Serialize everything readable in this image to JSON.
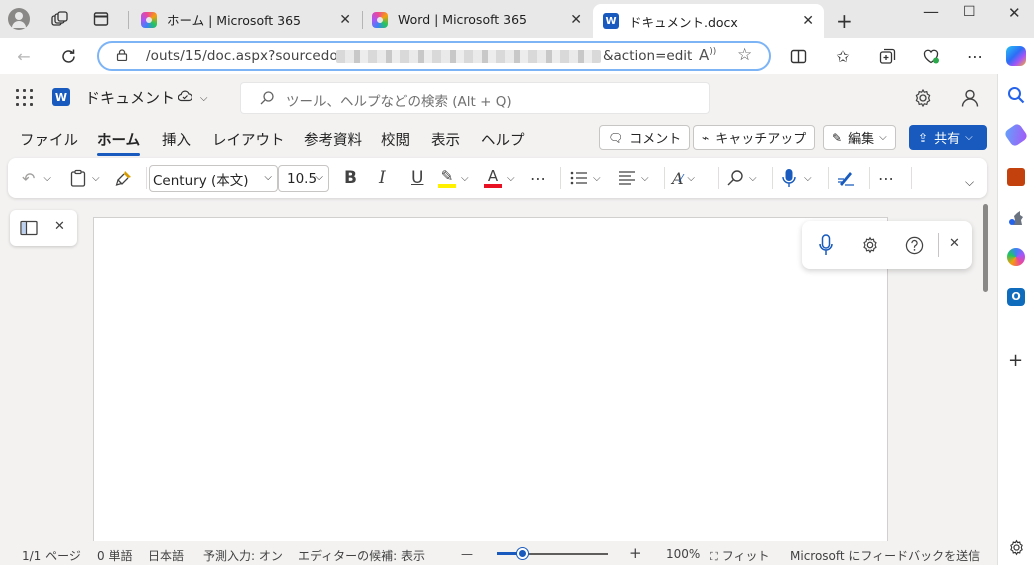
{
  "browser": {
    "tabs": [
      {
        "title": "ホーム | Microsoft 365",
        "active": false
      },
      {
        "title": "Word | Microsoft 365",
        "active": false
      },
      {
        "title": "ドキュメント.docx",
        "active": true
      }
    ],
    "address": {
      "url_start": "/outs/15/doc.aspx?sourcedoc=",
      "url_end": "&action=edit"
    },
    "colors": {
      "accent": "#185abd",
      "address_border": "#7db4f5"
    }
  },
  "word": {
    "doc_title": "ドキュメント",
    "search_placeholder": "ツール、ヘルプなどの検索 (Alt + Q)",
    "menu_tabs": [
      "ファイル",
      "ホーム",
      "挿入",
      "レイアウト",
      "参考資料",
      "校閲",
      "表示",
      "ヘルプ"
    ],
    "active_menu_tab": "ホーム",
    "comment_label": "コメント",
    "catchup_label": "キャッチアップ",
    "edit_label": "編集",
    "share_label": "共有",
    "font_name": "Century (本文)",
    "font_size": "10.5",
    "ribbon_buttons": {
      "bold": "B",
      "italic": "I",
      "underline": "U",
      "font_color": "A"
    }
  },
  "status_bar": {
    "page": "1/1 ページ",
    "words": "0 単語",
    "language": "日本語",
    "prediction": "予測入力: オン",
    "editor": "エディターの候補: 表示",
    "zoom_minus": "—",
    "zoom_plus": "+",
    "zoom": "100%",
    "fit": "フィット",
    "feedback": "Microsoft にフィードバックを送信"
  }
}
